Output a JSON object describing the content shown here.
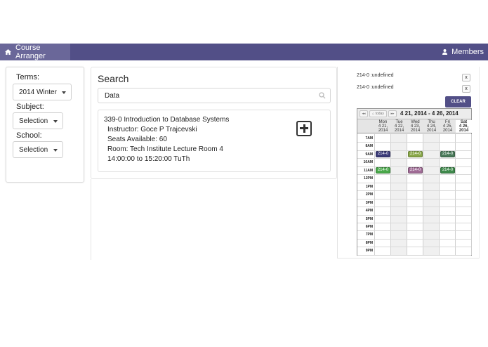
{
  "nav": {
    "brand": "Course Arranger",
    "brand_icon": "home-icon",
    "members": "Members",
    "members_icon": "user-icon",
    "bar_color": "#524f87"
  },
  "filters": {
    "terms_label": "Terms:",
    "terms_value": "2014 Winter",
    "subject_label": "Subject:",
    "subject_value": "Selection",
    "school_label": "School:",
    "school_value": "Selection"
  },
  "search": {
    "title": "Search",
    "query": "Data",
    "result": {
      "title": "339-0 Introduction to Database Systems",
      "instructor": "Instructor: Goce P Trajcevski",
      "seats": "Seats Available: 60",
      "room": "Room: Tech Institute Lecture Room 4",
      "time": "14:00:00 to 15:20:00 TuTh"
    }
  },
  "selected": [
    {
      "label": "214-0 :undefined",
      "remove": "x"
    },
    {
      "label": "214-0 :undefined",
      "remove": "x"
    }
  ],
  "clear_label": "CLEAR",
  "calendar": {
    "prev": "◂◂",
    "today": "⌂ today",
    "next": "▸▸",
    "range": "4 21, 2014 - 4 26, 2014",
    "days": [
      {
        "name": "Mon",
        "date": "4 21,",
        "year": "2014"
      },
      {
        "name": "Tue",
        "date": "4 22,",
        "year": "2014"
      },
      {
        "name": "Wed",
        "date": "4 23,",
        "year": "2014"
      },
      {
        "name": "Thu",
        "date": "4 24,",
        "year": "2014"
      },
      {
        "name": "Fri",
        "date": "4 25,",
        "year": "2014"
      },
      {
        "name": "Sat",
        "date": "4 26,",
        "year": "2014"
      }
    ],
    "hours": [
      "7AM",
      "8AM",
      "9AM",
      "10AM",
      "11AM",
      "12PM",
      "1PM",
      "2PM",
      "3PM",
      "4PM",
      "5PM",
      "6PM",
      "7PM",
      "8PM",
      "9PM"
    ],
    "events": [
      {
        "label": "214-0",
        "day": 0,
        "hour": 2,
        "color": "#3b3b78"
      },
      {
        "label": "214-0",
        "day": 2,
        "hour": 2,
        "color": "#8aa84a"
      },
      {
        "label": "214-0",
        "day": 4,
        "hour": 2,
        "color": "#4a7a5a"
      },
      {
        "label": "214-0",
        "day": 0,
        "hour": 4,
        "color": "#49a84a"
      },
      {
        "label": "214-0",
        "day": 2,
        "hour": 4,
        "color": "#a06c96"
      },
      {
        "label": "214-0",
        "day": 4,
        "hour": 4,
        "color": "#3f8a4c"
      }
    ]
  }
}
